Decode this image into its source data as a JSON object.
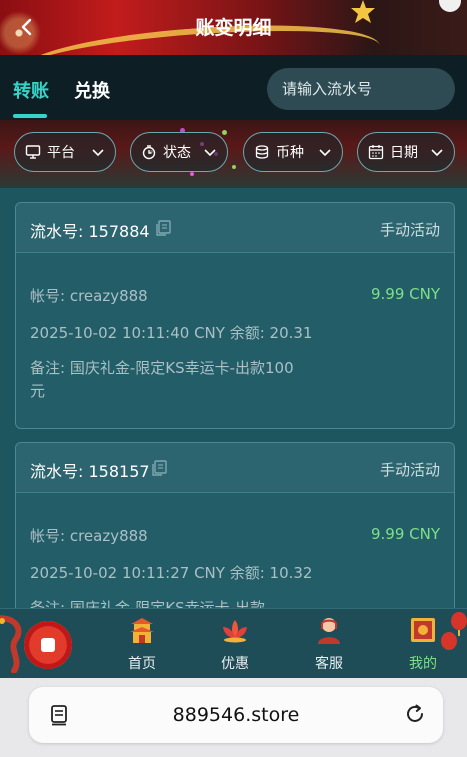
{
  "header": {
    "title": "账变明细"
  },
  "tabs": [
    {
      "label": "转账",
      "active": true
    },
    {
      "label": "兑换",
      "active": false
    }
  ],
  "search": {
    "placeholder": "请输入流水号"
  },
  "filters": [
    {
      "label": "平台",
      "icon": "monitor-icon"
    },
    {
      "label": "状态",
      "icon": "status-icon"
    },
    {
      "label": "币种",
      "icon": "coin-stack-icon"
    },
    {
      "label": "日期",
      "icon": "calendar-icon"
    }
  ],
  "records": [
    {
      "serial": "流水号: 157884",
      "type": "手动活动",
      "account": "帐号: creazy888",
      "amount": "9.99 CNY",
      "datetime": "2025-10-02 10:11:40 CNY 余额: 20.31",
      "remark": "备注: 国庆礼金-限定KS幸运卡-出款100元"
    },
    {
      "serial": "流水号: 158157",
      "type": "手动活动",
      "account": "帐号: creazy888",
      "amount": "9.99 CNY",
      "datetime": "2025-10-02 10:11:27 CNY 余额: 10.32",
      "remark": "备注: 国庆礼金-限定KS幸运卡-出款"
    }
  ],
  "nav": [
    {
      "label": "首页",
      "icon": "home-pagoda-icon",
      "active": false
    },
    {
      "label": "优惠",
      "icon": "lotus-promo-icon",
      "active": false
    },
    {
      "label": "客服",
      "icon": "support-agent-icon",
      "active": false
    },
    {
      "label": "我的",
      "icon": "profile-frame-icon",
      "active": true
    }
  ],
  "browser": {
    "url": "889546.store"
  },
  "colors": {
    "accent": "#36d3c8",
    "amount": "#7de08a",
    "background": "#1e5660"
  }
}
